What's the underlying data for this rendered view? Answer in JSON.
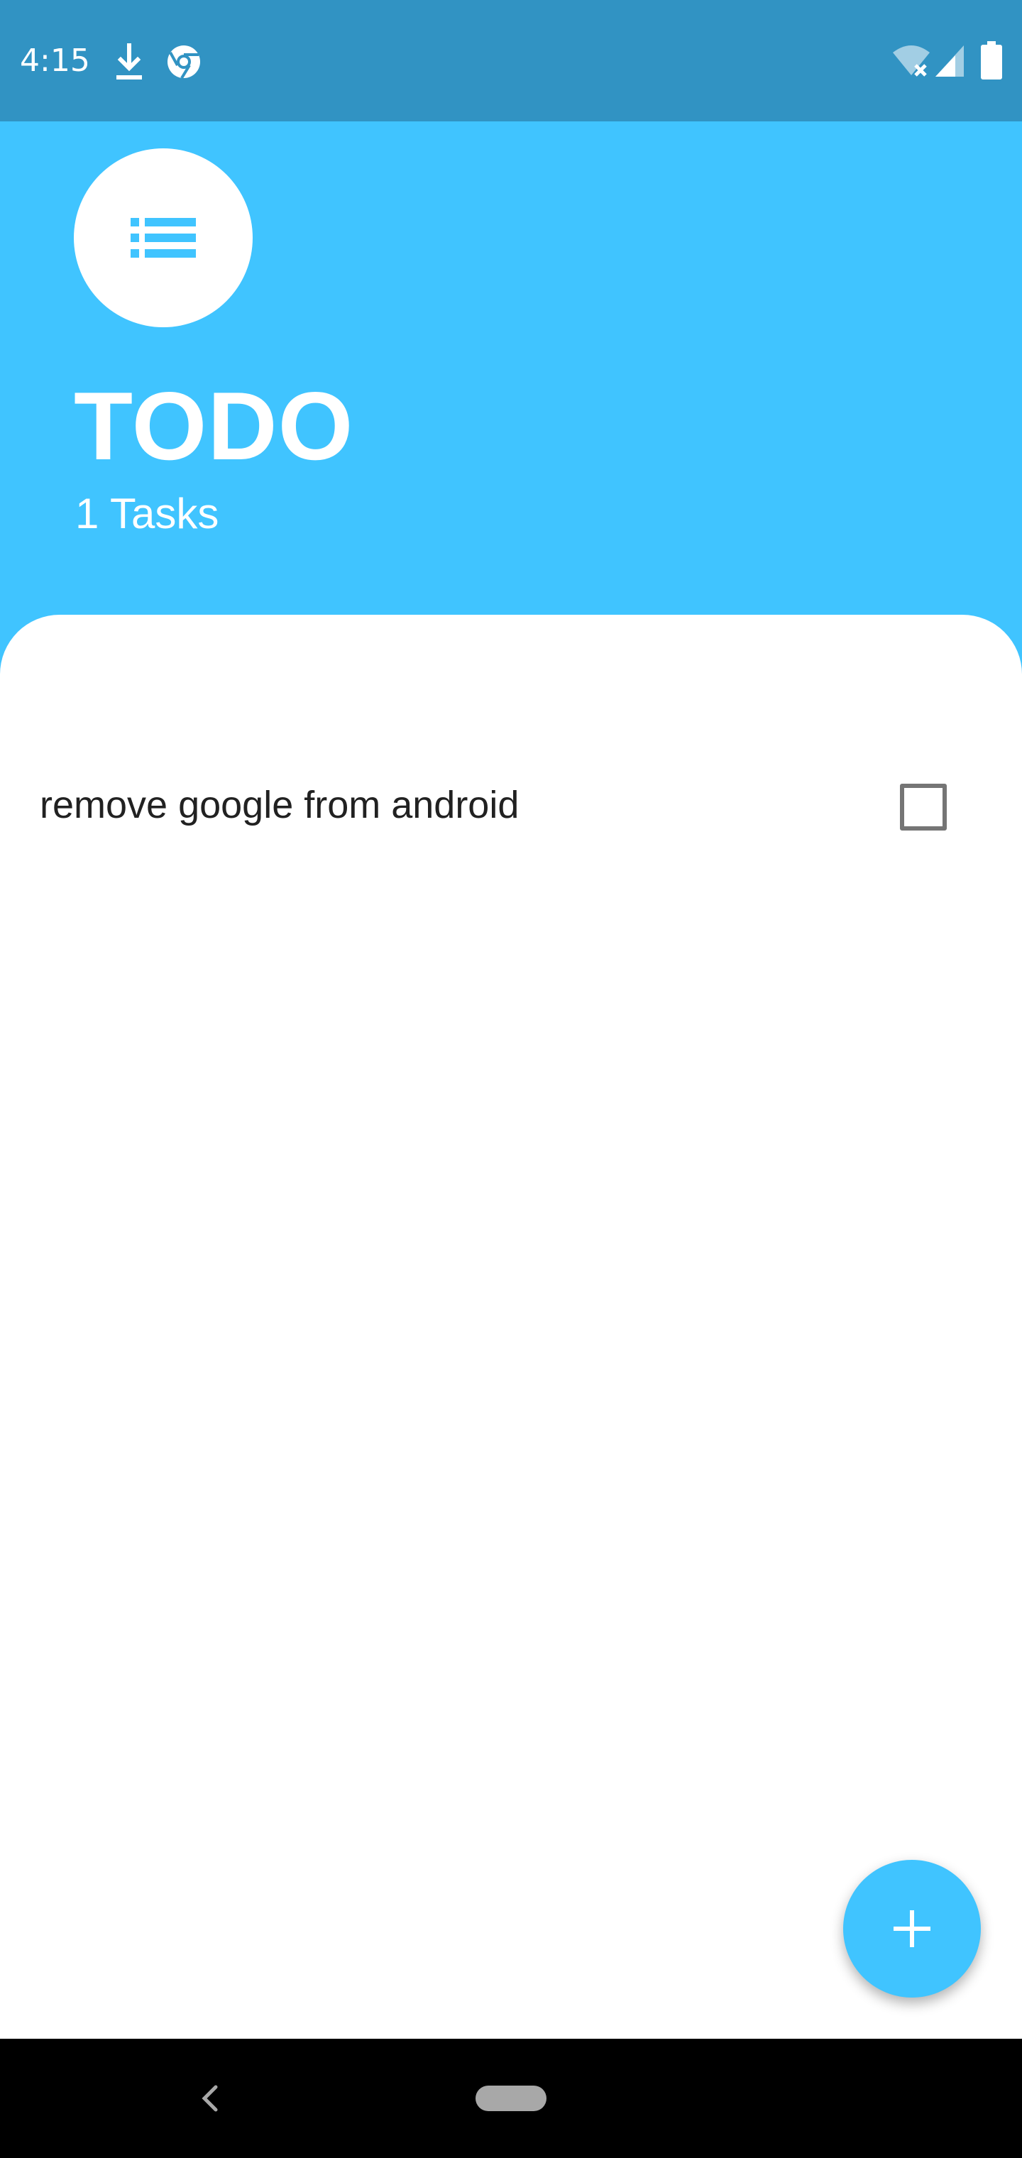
{
  "status_bar": {
    "time": "4:15",
    "icons": [
      "download-icon",
      "chrome-icon",
      "wifi-off-icon",
      "cell-signal-icon",
      "battery-icon"
    ]
  },
  "header": {
    "icon": "list-icon",
    "title": "TODO",
    "task_count": "1 Tasks"
  },
  "tasks": [
    {
      "label": "remove google from android",
      "checked": false
    }
  ],
  "fab": {
    "icon": "plus-icon"
  },
  "nav_bar": {
    "icons": [
      "back-icon",
      "home-pill-icon"
    ]
  },
  "colors": {
    "accent": "#40c4ff",
    "status_bar": "#3193c3",
    "surface": "#ffffff",
    "text_primary": "#212121",
    "checkbox_border": "#757575",
    "nav_bar": "#000000"
  }
}
